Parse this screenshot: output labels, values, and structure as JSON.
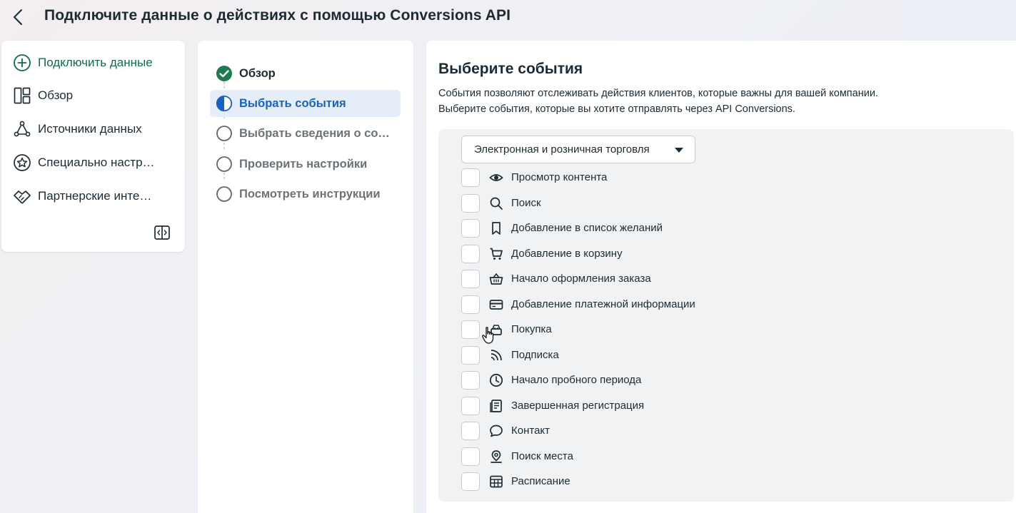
{
  "header": {
    "title": "Подключите данные о действиях с помощью Conversions API"
  },
  "sidebar": {
    "items": [
      {
        "label": "Подключить данные",
        "icon": "plus-circle-icon"
      },
      {
        "label": "Обзор",
        "icon": "layout-icon"
      },
      {
        "label": "Источники данных",
        "icon": "nodes-icon"
      },
      {
        "label": "Специально настр…",
        "icon": "star-badge-icon"
      },
      {
        "label": "Партнерские инте…",
        "icon": "handshake-icon"
      }
    ]
  },
  "steps": [
    {
      "label": "Обзор",
      "state": "done"
    },
    {
      "label": "Выбрать события",
      "state": "active"
    },
    {
      "label": "Выбрать сведения о со…",
      "state": "pending"
    },
    {
      "label": "Проверить настройки",
      "state": "pending"
    },
    {
      "label": "Посмотреть инструкции",
      "state": "pending"
    }
  ],
  "main": {
    "title": "Выберите события",
    "description": "События позволяют отслеживать действия клиентов, которые важны для вашей компании. Выберите события, которые вы хотите отправлять через API Conversions.",
    "category_selected": "Электронная и розничная торговля",
    "events": [
      {
        "label": "Просмотр контента",
        "icon": "eye-icon",
        "checked": false
      },
      {
        "label": "Поиск",
        "icon": "search-icon",
        "checked": false
      },
      {
        "label": "Добавление в список желаний",
        "icon": "bookmark-icon",
        "checked": false
      },
      {
        "label": "Добавление в корзину",
        "icon": "cart-icon",
        "checked": false
      },
      {
        "label": "Начало оформления заказа",
        "icon": "basket-icon",
        "checked": false
      },
      {
        "label": "Добавление платежной информации",
        "icon": "credit-card-icon",
        "checked": false
      },
      {
        "label": "Покупка",
        "icon": "purchase-icon",
        "checked": false
      },
      {
        "label": "Подписка",
        "icon": "rss-icon",
        "checked": false
      },
      {
        "label": "Начало пробного периода",
        "icon": "clock-icon",
        "checked": false
      },
      {
        "label": "Завершенная регистрация",
        "icon": "registration-icon",
        "checked": false
      },
      {
        "label": "Контакт",
        "icon": "chat-icon",
        "checked": false
      },
      {
        "label": "Поиск места",
        "icon": "location-icon",
        "checked": false
      },
      {
        "label": "Расписание",
        "icon": "calendar-icon",
        "checked": false
      }
    ]
  },
  "colors": {
    "accent_green": "#0f6b4a",
    "active_blue": "#1763c4",
    "active_bg": "#e4edf8",
    "done_check": "#1e7a4f"
  }
}
